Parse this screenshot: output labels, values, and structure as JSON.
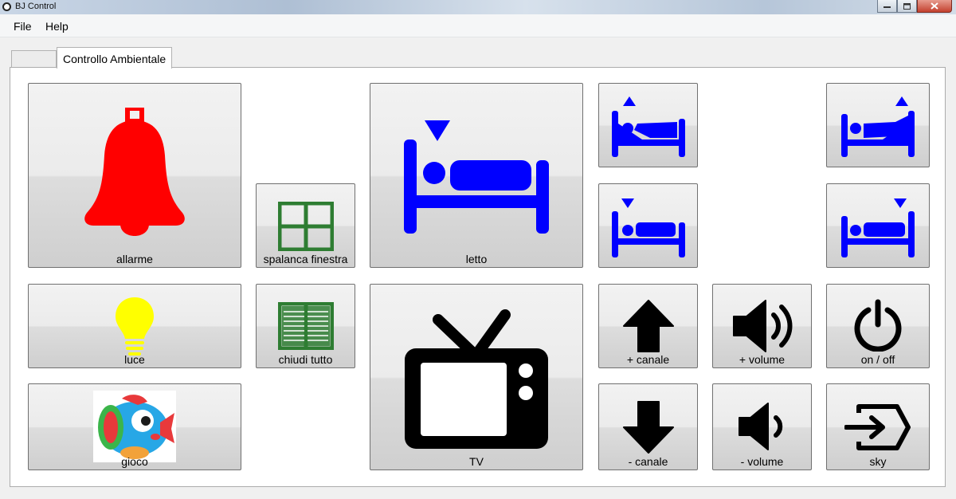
{
  "window": {
    "title": "BJ Control"
  },
  "menu": {
    "file": "File",
    "help": "Help"
  },
  "tabs": [
    {
      "label": ""
    },
    {
      "label": "Controllo Ambientale"
    }
  ],
  "buttons": {
    "allarme": "allarme",
    "spalanca_finestra": "spalanca finestra",
    "letto": "letto",
    "luce": "luce",
    "chiudi_tutto": "chiudi tutto",
    "tv": "TV",
    "gioco": "gioco",
    "canale_up": "+ canale",
    "volume_up": "+ volume",
    "on_off": "on / off",
    "canale_down": "- canale",
    "volume_down": "- volume",
    "sky": "sky"
  },
  "colors": {
    "bell": "#ff0000",
    "bed": "#0000ff",
    "window_icon": "#2e7d32",
    "bulb": "#ffff00",
    "tv_controls": "#000000"
  },
  "icons": {
    "allarme": "bell-icon",
    "spalanca_finestra": "window-open-icon",
    "letto": "bed-down-icon",
    "bed_head_up": "bed-head-up-icon",
    "bed_feet_up": "bed-feet-up-icon",
    "bed_head_down": "bed-head-down-icon",
    "bed_feet_down": "bed-feet-down-icon",
    "luce": "lightbulb-icon",
    "chiudi_tutto": "blinds-icon",
    "tv": "tv-icon",
    "gioco": "toy-fish-image",
    "canale_up": "arrow-up-icon",
    "volume_up": "speaker-up-icon",
    "on_off": "power-icon",
    "canale_down": "arrow-down-icon",
    "volume_down": "speaker-down-icon",
    "sky": "input-source-icon"
  }
}
